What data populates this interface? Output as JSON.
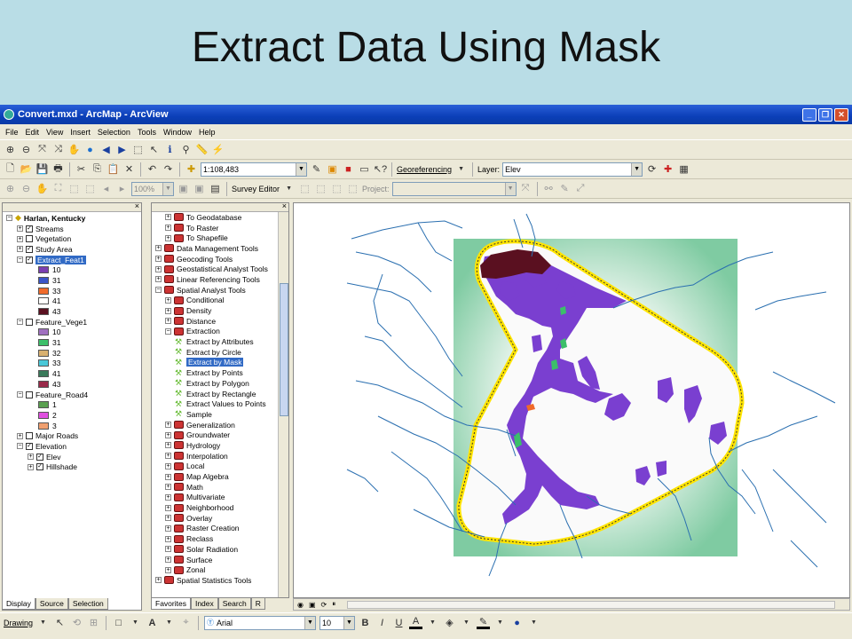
{
  "slide": {
    "title": "Extract Data Using Mask"
  },
  "window": {
    "title": "Convert.mxd - ArcMap - ArcView"
  },
  "menu": [
    "File",
    "Edit",
    "View",
    "Insert",
    "Selection",
    "Tools",
    "Window",
    "Help"
  ],
  "toolbar2": {
    "scale": "1:108,483",
    "georeferencing_label": "Georeferencing",
    "layer_label": "Layer:",
    "layer_value": "Elev"
  },
  "toolbar3": {
    "zoom": "100%",
    "survey_editor": "Survey Editor",
    "project_label": "Project:"
  },
  "toc": {
    "items": [
      {
        "indent": 0,
        "type": "frame",
        "label": "Harlan, Kentucky"
      },
      {
        "indent": 1,
        "type": "layer",
        "checked": true,
        "label": "Streams"
      },
      {
        "indent": 1,
        "type": "layer",
        "checked": false,
        "label": "Vegetation"
      },
      {
        "indent": 1,
        "type": "layer",
        "checked": true,
        "label": "Study Area"
      },
      {
        "indent": 1,
        "type": "layer",
        "checked": true,
        "label": "Extract_Feat1",
        "selected": true
      },
      {
        "indent": 3,
        "type": "legend",
        "color": "#7b3fb0",
        "label": "10"
      },
      {
        "indent": 3,
        "type": "legend",
        "color": "#3a55c8",
        "label": "31"
      },
      {
        "indent": 3,
        "type": "legend",
        "color": "#f06a2a",
        "label": "33"
      },
      {
        "indent": 3,
        "type": "legend",
        "color": "#ffffff",
        "label": "41"
      },
      {
        "indent": 3,
        "type": "legend",
        "color": "#5a1020",
        "label": "43"
      },
      {
        "indent": 1,
        "type": "layer",
        "checked": false,
        "label": "Feature_Vege1"
      },
      {
        "indent": 3,
        "type": "legend",
        "color": "#a070c0",
        "label": "10"
      },
      {
        "indent": 3,
        "type": "legend",
        "color": "#3cbf6a",
        "label": "31"
      },
      {
        "indent": 3,
        "type": "legend",
        "color": "#d8b070",
        "label": "32"
      },
      {
        "indent": 3,
        "type": "legend",
        "color": "#4ac8d8",
        "label": "33"
      },
      {
        "indent": 3,
        "type": "legend",
        "color": "#3a7a5a",
        "label": "41"
      },
      {
        "indent": 3,
        "type": "legend",
        "color": "#9a2a4a",
        "label": "43"
      },
      {
        "indent": 1,
        "type": "layer",
        "checked": false,
        "label": "Feature_Road4"
      },
      {
        "indent": 3,
        "type": "legend",
        "color": "#5aa050",
        "label": "1"
      },
      {
        "indent": 3,
        "type": "legend",
        "color": "#e050e0",
        "label": "2"
      },
      {
        "indent": 3,
        "type": "legend",
        "color": "#f0a070",
        "label": "3"
      },
      {
        "indent": 1,
        "type": "layer",
        "checked": false,
        "label": "Major Roads"
      },
      {
        "indent": 1,
        "type": "layer",
        "checked": true,
        "label": "Elevation"
      },
      {
        "indent": 2,
        "type": "layer",
        "checked": true,
        "label": "Elev"
      },
      {
        "indent": 2,
        "type": "layer",
        "checked": true,
        "label": "Hillshade"
      }
    ],
    "tabs": [
      "Display",
      "Source",
      "Selection"
    ]
  },
  "arctoolbox": {
    "items": [
      {
        "indent": 1,
        "type": "toolset",
        "label": "To Geodatabase"
      },
      {
        "indent": 1,
        "type": "toolset",
        "label": "To Raster"
      },
      {
        "indent": 1,
        "type": "toolset",
        "label": "To Shapefile"
      },
      {
        "indent": 0,
        "type": "toolbox",
        "label": "Data Management Tools"
      },
      {
        "indent": 0,
        "type": "toolbox",
        "label": "Geocoding Tools"
      },
      {
        "indent": 0,
        "type": "toolbox",
        "label": "Geostatistical Analyst Tools"
      },
      {
        "indent": 0,
        "type": "toolbox",
        "label": "Linear Referencing Tools"
      },
      {
        "indent": 0,
        "type": "toolbox",
        "label": "Spatial Analyst Tools"
      },
      {
        "indent": 1,
        "type": "toolset",
        "label": "Conditional"
      },
      {
        "indent": 1,
        "type": "toolset",
        "label": "Density"
      },
      {
        "indent": 1,
        "type": "toolset",
        "label": "Distance"
      },
      {
        "indent": 1,
        "type": "toolset",
        "label": "Extraction"
      },
      {
        "indent": 2,
        "type": "tool",
        "label": "Extract by Attributes"
      },
      {
        "indent": 2,
        "type": "tool",
        "label": "Extract by Circle"
      },
      {
        "indent": 2,
        "type": "tool",
        "label": "Extract by Mask",
        "selected": true
      },
      {
        "indent": 2,
        "type": "tool",
        "label": "Extract by Points"
      },
      {
        "indent": 2,
        "type": "tool",
        "label": "Extract by Polygon"
      },
      {
        "indent": 2,
        "type": "tool",
        "label": "Extract by Rectangle"
      },
      {
        "indent": 2,
        "type": "tool",
        "label": "Extract Values to Points"
      },
      {
        "indent": 2,
        "type": "tool",
        "label": "Sample"
      },
      {
        "indent": 1,
        "type": "toolset",
        "label": "Generalization"
      },
      {
        "indent": 1,
        "type": "toolset",
        "label": "Groundwater"
      },
      {
        "indent": 1,
        "type": "toolset",
        "label": "Hydrology"
      },
      {
        "indent": 1,
        "type": "toolset",
        "label": "Interpolation"
      },
      {
        "indent": 1,
        "type": "toolset",
        "label": "Local"
      },
      {
        "indent": 1,
        "type": "toolset",
        "label": "Map Algebra"
      },
      {
        "indent": 1,
        "type": "toolset",
        "label": "Math"
      },
      {
        "indent": 1,
        "type": "toolset",
        "label": "Multivariate"
      },
      {
        "indent": 1,
        "type": "toolset",
        "label": "Neighborhood"
      },
      {
        "indent": 1,
        "type": "toolset",
        "label": "Overlay"
      },
      {
        "indent": 1,
        "type": "toolset",
        "label": "Raster Creation"
      },
      {
        "indent": 1,
        "type": "toolset",
        "label": "Reclass"
      },
      {
        "indent": 1,
        "type": "toolset",
        "label": "Solar Radiation"
      },
      {
        "indent": 1,
        "type": "toolset",
        "label": "Surface"
      },
      {
        "indent": 1,
        "type": "toolset",
        "label": "Zonal"
      },
      {
        "indent": 0,
        "type": "toolbox",
        "label": "Spatial Statistics Tools"
      }
    ],
    "tabs": [
      "Favorites",
      "Index",
      "Search",
      "R"
    ]
  },
  "drawing": {
    "label": "Drawing",
    "font": "Arial",
    "size": "10",
    "bold": "B",
    "italic": "I",
    "underline": "U",
    "font_color": "A"
  },
  "colors": {
    "slide_bg": "#b9dde6",
    "title_bar": "#0b3fb8",
    "selection": "#316ac5",
    "mask_fill": "#7a3fd0",
    "boundary": "#ffe400",
    "stream": "#2a6fb0"
  }
}
